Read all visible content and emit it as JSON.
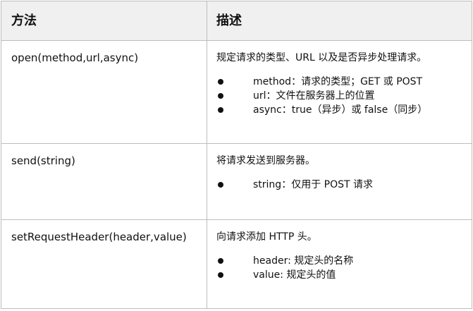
{
  "table": {
    "headers": {
      "method": "方法",
      "description": "描述"
    },
    "rows": [
      {
        "method": "open(method,url,async)",
        "description": "规定请求的类型、URL 以及是否异步处理请求。",
        "bullets": [
          "method：请求的类型；GET 或 POST",
          "url：文件在服务器上的位置",
          "async：true（异步）或 false（同步）"
        ]
      },
      {
        "method": "send(string)",
        "description": "将请求发送到服务器。",
        "bullets": [
          "string：仅用于 POST 请求"
        ]
      },
      {
        "method": "setRequestHeader(header,value)",
        "description": "向请求添加 HTTP 头。",
        "bullets": [
          "header: 规定头的名称",
          "value: 规定头的值"
        ]
      }
    ]
  }
}
